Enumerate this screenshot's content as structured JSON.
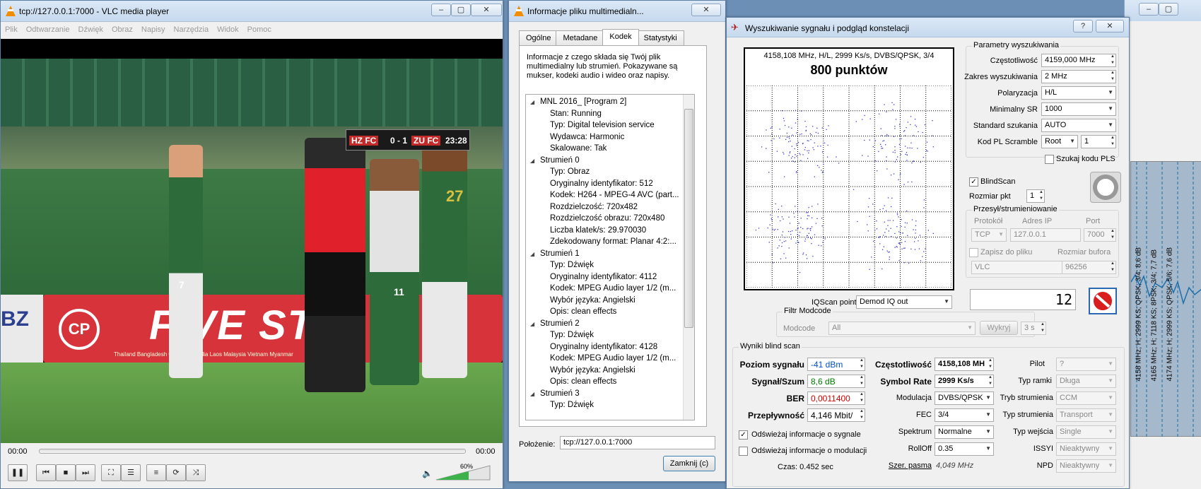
{
  "vlc": {
    "title": "tcp://127.0.0.1:7000 - VLC media player",
    "menu": [
      "Plik",
      "Odtwarzanie",
      "Dźwięk",
      "Obraz",
      "Napisy",
      "Narzędzia",
      "Widok",
      "Pomoc"
    ],
    "time_current": "00:00",
    "time_total": "00:00",
    "volume": "60%",
    "scoreboard": {
      "home": "HZ FC",
      "score": "0 - 1",
      "away": "ZU FC",
      "clock": "23:28"
    },
    "board_text": "FIVE STA",
    "board_logo": "CP",
    "board_sub": "Thailand  Bangladesh  Cambodia  India  Laos  Malaysia  Vietnam  Myanmar",
    "left_board": "BZ",
    "jersey_numbers": [
      "7",
      "11",
      "27"
    ]
  },
  "info": {
    "title": "Informacje pliku multimedialn...",
    "tabs": [
      "Ogólne",
      "Metadane",
      "Kodek",
      "Statystyki"
    ],
    "active_tab": "Kodek",
    "description": "Informacje z czego składa się Twój plik multimedialny lub strumień. Pokazywane są mukser, kodeki audio i wideo oraz napisy.",
    "tree": [
      {
        "level": 0,
        "text": "MNL 2016_ [Program 2]",
        "expanded": true
      },
      {
        "level": 1,
        "text": "Stan: Running"
      },
      {
        "level": 1,
        "text": "Typ: Digital television service"
      },
      {
        "level": 1,
        "text": "Wydawca: Harmonic"
      },
      {
        "level": 1,
        "text": "Skalowane: Tak"
      },
      {
        "level": 0,
        "text": "Strumień 0",
        "expanded": true
      },
      {
        "level": 1,
        "text": "Typ: Obraz"
      },
      {
        "level": 1,
        "text": "Oryginalny identyfikator: 512"
      },
      {
        "level": 1,
        "text": "Kodek: H264 - MPEG-4 AVC (part..."
      },
      {
        "level": 1,
        "text": "Rozdzielczość: 720x482"
      },
      {
        "level": 1,
        "text": "Rozdzielczość obrazu: 720x480"
      },
      {
        "level": 1,
        "text": "Liczba klatek/s: 29.970030"
      },
      {
        "level": 1,
        "text": "Zdekodowany format: Planar 4:2:..."
      },
      {
        "level": 0,
        "text": "Strumień 1",
        "expanded": true
      },
      {
        "level": 1,
        "text": "Typ: Dźwięk"
      },
      {
        "level": 1,
        "text": "Oryginalny identyfikator: 4112"
      },
      {
        "level": 1,
        "text": "Kodek: MPEG Audio layer 1/2 (m..."
      },
      {
        "level": 1,
        "text": "Wybór języka: Angielski"
      },
      {
        "level": 1,
        "text": "Opis: clean effects"
      },
      {
        "level": 0,
        "text": "Strumień 2",
        "expanded": true
      },
      {
        "level": 1,
        "text": "Typ: Dźwięk"
      },
      {
        "level": 1,
        "text": "Oryginalny identyfikator: 4128"
      },
      {
        "level": 1,
        "text": "Kodek: MPEG Audio layer 1/2 (m..."
      },
      {
        "level": 1,
        "text": "Wybór języka: Angielski"
      },
      {
        "level": 1,
        "text": "Opis: clean effects"
      },
      {
        "level": 0,
        "text": "Strumień 3",
        "expanded": true
      },
      {
        "level": 1,
        "text": "Typ: Dźwięk"
      }
    ],
    "location_label": "Położenie:",
    "location_value": "tcp://127.0.0.1:7000",
    "close_button": "Zamknij (c)"
  },
  "signal": {
    "title": "Wyszukiwanie sygnału i podgląd konstelacji",
    "help_btn": "?",
    "close_btn": "✕",
    "constellation": {
      "header": "4158,108 MHz, H/L, 2999 Ks/s, DVBS/QPSK, 3/4",
      "points_label": "800 punktów"
    },
    "params": {
      "group": "Parametry wyszukiwania",
      "freq_label": "Częstotliwość",
      "freq_value": "4159,000 MHz",
      "range_label": "Zakres wyszukiwania",
      "range_value": "2 MHz",
      "pol_label": "Polaryzacja",
      "pol_value": "H/L",
      "sr_label": "Minimalny SR",
      "sr_value": "1000",
      "std_label": "Standard szukania",
      "std_value": "AUTO",
      "pls_label": "Kod PL Scramble",
      "pls_mode": "Root",
      "pls_value": "1",
      "pls_search": "Szukaj kodu PLS"
    },
    "blindscan_label": "BlindScan",
    "pt_size_label": "Rozmiar pkt",
    "pt_size_value": "1",
    "stream": {
      "group": "Przesył/strumieniowanie",
      "protocol_label": "Protokół",
      "ip_label": "Adres IP",
      "port_label": "Port",
      "protocol": "TCP",
      "ip": "127.0.0.1",
      "port": "7000",
      "save_label": "Zapisz do pliku",
      "buffer_label": "Rozmiar bufora",
      "player": "VLC",
      "buffer": "96256"
    },
    "iq_label": "IQScan point",
    "iq_value": "Demod IQ out",
    "counter": "12",
    "modcode": {
      "group": "Filtr Modcode",
      "label": "Modcode",
      "value": "All",
      "detect": "Wykryj",
      "timeout": "3 s"
    },
    "results": {
      "group": "Wyniki blind scan",
      "level_label": "Poziom sygnału",
      "level_value": "-41 dBm",
      "snr_label": "Sygnał/Szum",
      "snr_value": "8,6 dB",
      "ber_label": "BER",
      "ber_value": "0,0011400",
      "rate_label": "Przepływność",
      "rate_value": "4,146 Mbit/",
      "freq_label": "Częstotliwość",
      "freq_value": "4158,108 MH",
      "sr_label": "Symbol Rate",
      "sr_value": "2999 Ks/s",
      "mod_label": "Modulacja",
      "mod_value": "DVBS/QPSK",
      "fec_label": "FEC",
      "fec_value": "3/4",
      "spec_label": "Spektrum",
      "spec_value": "Normalne",
      "rolloff_label": "RollOff",
      "rolloff_value": "0.35",
      "bw_label": "Szer. pasma",
      "bw_value": "4,049 MHz",
      "pilot_label": "Pilot",
      "pilot_value": "?",
      "frame_label": "Typ ramki",
      "frame_value": "Długa",
      "smode_label": "Tryb strumienia",
      "smode_value": "CCM",
      "stype_label": "Typ strumienia",
      "stype_value": "Transport",
      "input_label": "Typ wejścia",
      "input_value": "Single",
      "issyi_label": "ISSYI",
      "issyi_value": "Nieaktywny",
      "npd_label": "NPD",
      "npd_value": "Nieaktywny",
      "refresh_signal": "Odświeżaj informacje o sygnale",
      "refresh_mod": "Odświeżaj informacje o modulacji",
      "time": "Czas: 0.452 sec"
    }
  },
  "bg_window": {
    "labels": [
      "4158 MHz; H; 2999 KS; QPSK; 3/4; 8,6 dB",
      "4165 MHz; H; 7118 KS; 8PSK; 3/4; 7,7 dB",
      "4174 MHz; H; 2999 KS; QPSK; 5/6; 7,6 dB"
    ]
  },
  "colors": {
    "accent_blue": "#0050c8",
    "ber_red": "#d00000",
    "snr_green": "#007a00"
  }
}
